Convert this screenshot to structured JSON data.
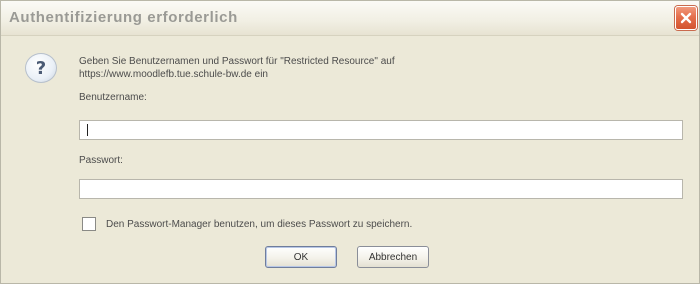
{
  "window": {
    "title": "Authentifizierung erforderlich"
  },
  "dialog": {
    "message_line1": "Geben Sie Benutzernamen und Passwort für \"Restricted Resource\" auf",
    "message_line2": "https://www.moodlefb.tue.schule-bw.de ein",
    "username_label": "Benutzername:",
    "username_value": "",
    "password_label": "Passwort:",
    "password_value": "",
    "checkbox_label": "Den Passwort-Manager benutzen, um dieses Passwort zu speichern.",
    "checkbox_checked": false,
    "ok_label": "OK",
    "cancel_label": "Abbrechen"
  },
  "icons": {
    "close": "close-icon",
    "help": "question-icon"
  },
  "colors": {
    "close_button": "#e56f4c",
    "dialog_background": "#ece9d8",
    "title_text": "#9a9a95"
  }
}
